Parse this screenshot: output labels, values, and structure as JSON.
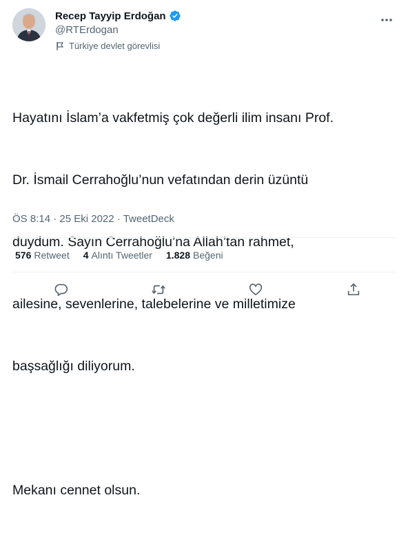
{
  "user": {
    "display_name": "Recep Tayyip Erdoğan",
    "handle": "@RTErdogan",
    "label": "Türkiye devlet görevlisi"
  },
  "tweet": {
    "lines": [
      "Hayatını İslam’a vakfetmiş çok değerli ilim insanı Prof.",
      "Dr. İsmail Cerrahoğlu’nun vefatından derin üzüntü",
      "duydum. Sayın Cerrahoğlu’na Allah’tan rahmet,",
      "ailesine, sevenlerine, talebelerine ve milletimize",
      "başsağlığı diliyorum."
    ],
    "closing": "Mekanı cennet olsun."
  },
  "meta": {
    "time": "ÖS 8:14",
    "separator": "·",
    "date": "25 Eki 2022",
    "source": "TweetDeck"
  },
  "stats": {
    "retweets_count": "576",
    "retweets_label": "Retweet",
    "quotes_count": "4",
    "quotes_label": "Alıntı Tweetler",
    "likes_count": "1.828",
    "likes_label": "Beğeni"
  },
  "icons": {
    "verified": "verified-badge-icon",
    "more": "more-icon",
    "flag": "flag-icon",
    "reply": "reply-icon",
    "retweet": "retweet-icon",
    "like": "heart-icon",
    "share": "share-icon"
  },
  "colors": {
    "verified": "#1d9bf0",
    "secondary_text": "#536471",
    "primary_text": "#0f1419"
  }
}
